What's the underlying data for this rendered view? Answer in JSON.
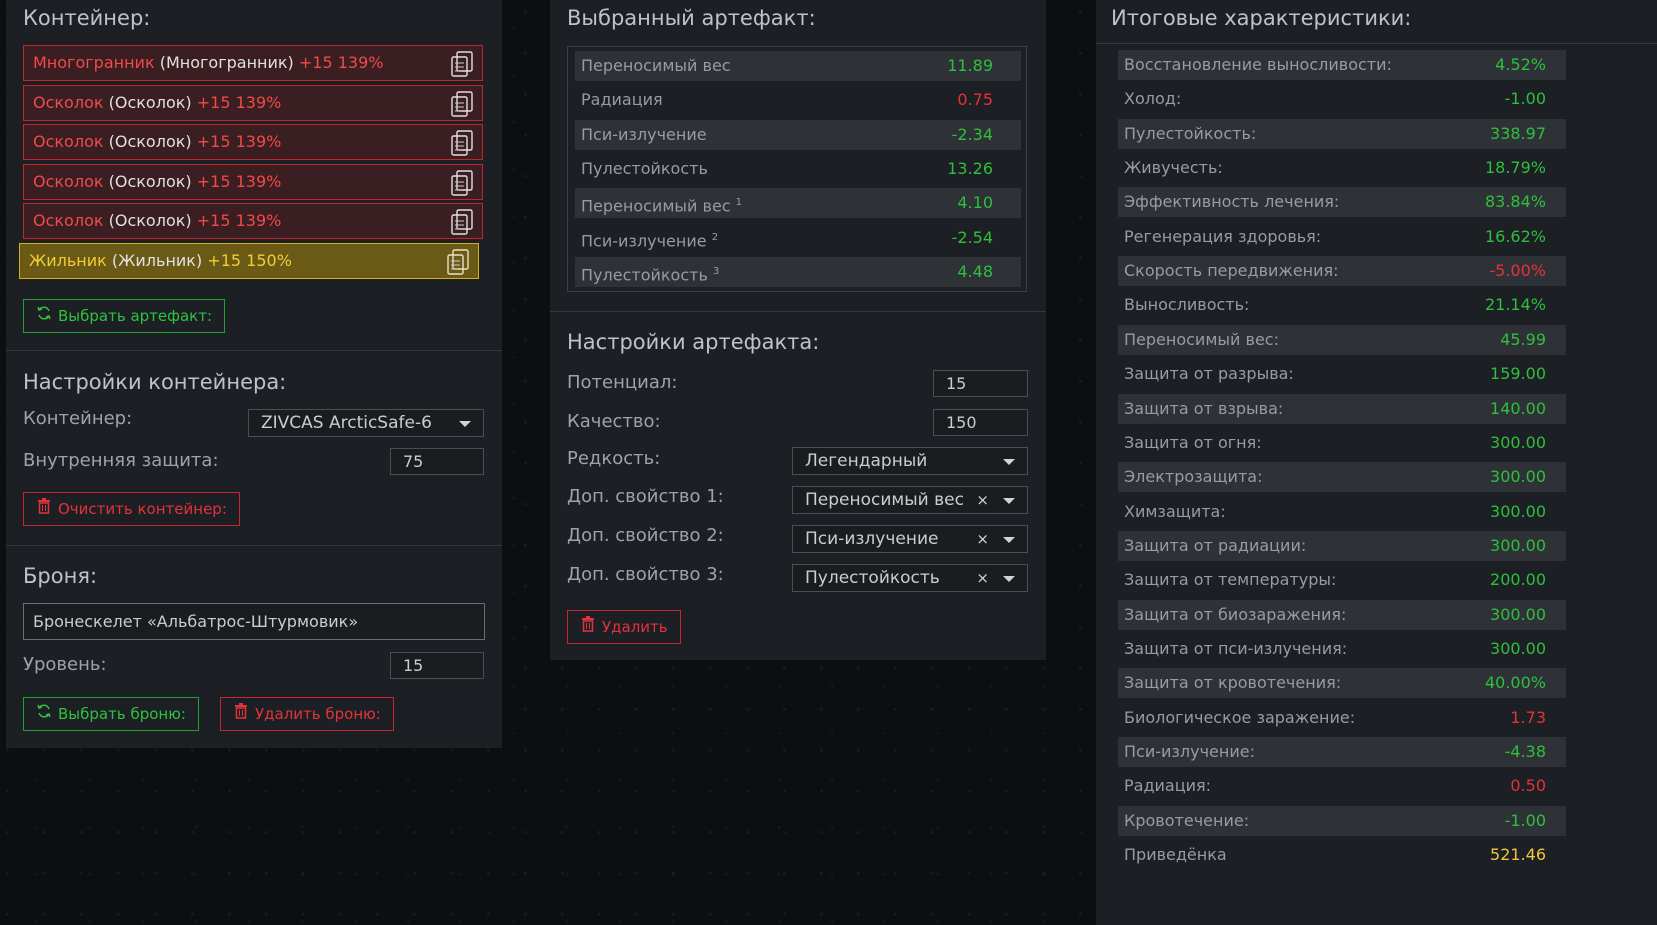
{
  "left": {
    "container_title": "Контейнер:",
    "artifacts": [
      {
        "name": "Многогранник",
        "paren": "(Многогранник)",
        "bonus": "+15 139%",
        "rarity": "red"
      },
      {
        "name": "Осколок",
        "paren": "(Осколок)",
        "bonus": "+15 139%",
        "rarity": "red"
      },
      {
        "name": "Осколок",
        "paren": "(Осколок)",
        "bonus": "+15 139%",
        "rarity": "red"
      },
      {
        "name": "Осколок",
        "paren": "(Осколок)",
        "bonus": "+15 139%",
        "rarity": "red"
      },
      {
        "name": "Осколок",
        "paren": "(Осколок)",
        "bonus": "+15 139%",
        "rarity": "red"
      },
      {
        "name": "Жильник",
        "paren": "(Жильник)",
        "bonus": "+15 150%",
        "rarity": "legend"
      }
    ],
    "select_artifact_btn": "Выбрать артефакт:",
    "container_settings_title": "Настройки контейнера:",
    "container_label": "Контейнер:",
    "container_value": "ZIVCAS ArcticSafe-6",
    "inner_protection_label": "Внутренняя защита:",
    "inner_protection_value": "75",
    "clear_container_btn": "Очистить контейнер:",
    "armor_title": "Броня:",
    "armor_value": "Бронескелет «Альбатрос-Штурмовик»",
    "level_label": "Уровень:",
    "level_value": "15",
    "select_armor_btn": "Выбрать броню:",
    "delete_armor_btn": "Удалить броню:"
  },
  "middle": {
    "selected_title": "Выбранный артефакт:",
    "props": [
      {
        "label": "Переносимый вес",
        "sup": "",
        "value": "11.89",
        "color": "g"
      },
      {
        "label": "Радиация",
        "sup": "",
        "value": "0.75",
        "color": "r"
      },
      {
        "label": "Пси-излучение",
        "sup": "",
        "value": "-2.34",
        "color": "g"
      },
      {
        "label": "Пулестойкость",
        "sup": "",
        "value": "13.26",
        "color": "g"
      },
      {
        "label": "Переносимый вес",
        "sup": "1",
        "value": "4.10",
        "color": "g"
      },
      {
        "label": "Пси-излучение",
        "sup": "2",
        "value": "-2.54",
        "color": "g"
      },
      {
        "label": "Пулестойкость",
        "sup": "3",
        "value": "4.48",
        "color": "g"
      }
    ],
    "settings_title": "Настройки артефакта:",
    "potential_label": "Потенциал:",
    "potential_value": "15",
    "quality_label": "Качество:",
    "quality_value": "150",
    "rarity_label": "Редкость:",
    "rarity_value": "Легендарный",
    "extra1_label": "Доп. свойство 1:",
    "extra1_value": "Переносимый вес",
    "extra2_label": "Доп. свойство 2:",
    "extra2_value": "Пси-излучение",
    "extra3_label": "Доп. свойство 3:",
    "extra3_value": "Пулестойкость",
    "clear_symbol": "×",
    "delete_btn": "Удалить"
  },
  "right": {
    "title": "Итоговые характеристики:",
    "stats": [
      {
        "label": "Восстановление выносливости:",
        "value": "4.52%",
        "color": "g"
      },
      {
        "label": "Холод:",
        "value": "-1.00",
        "color": "g"
      },
      {
        "label": "Пулестойкость:",
        "value": "338.97",
        "color": "g"
      },
      {
        "label": "Живучесть:",
        "value": "18.79%",
        "color": "g"
      },
      {
        "label": "Эффективность лечения:",
        "value": "83.84%",
        "color": "g"
      },
      {
        "label": "Регенерация здоровья:",
        "value": "16.62%",
        "color": "g"
      },
      {
        "label": "Скорость передвижения:",
        "value": "-5.00%",
        "color": "r"
      },
      {
        "label": "Выносливость:",
        "value": "21.14%",
        "color": "g"
      },
      {
        "label": "Переносимый вес:",
        "value": "45.99",
        "color": "g"
      },
      {
        "label": "Защита от разрыва:",
        "value": "159.00",
        "color": "g"
      },
      {
        "label": "Защита от взрыва:",
        "value": "140.00",
        "color": "g"
      },
      {
        "label": "Защита от огня:",
        "value": "300.00",
        "color": "g"
      },
      {
        "label": "Электрозащита:",
        "value": "300.00",
        "color": "g"
      },
      {
        "label": "Химзащита:",
        "value": "300.00",
        "color": "g"
      },
      {
        "label": "Защита от радиации:",
        "value": "300.00",
        "color": "g"
      },
      {
        "label": "Защита от температуры:",
        "value": "200.00",
        "color": "g"
      },
      {
        "label": "Защита от биозаражения:",
        "value": "300.00",
        "color": "g"
      },
      {
        "label": "Защита от пси-излучения:",
        "value": "300.00",
        "color": "g"
      },
      {
        "label": "Защита от кровотечения:",
        "value": "40.00%",
        "color": "g"
      },
      {
        "label": "Биологическое заражение:",
        "value": "1.73",
        "color": "r"
      },
      {
        "label": "Пси-излучение:",
        "value": "-4.38",
        "color": "g"
      },
      {
        "label": "Радиация:",
        "value": "0.50",
        "color": "r"
      },
      {
        "label": "Кровотечение:",
        "value": "-1.00",
        "color": "g"
      },
      {
        "label": "Приведёнка",
        "value": "521.46",
        "color": "y"
      }
    ]
  },
  "colors": {
    "green": "#2fbf3c",
    "red": "#e33239",
    "gold": "#f0c93a",
    "panel": "#1c1f24"
  }
}
